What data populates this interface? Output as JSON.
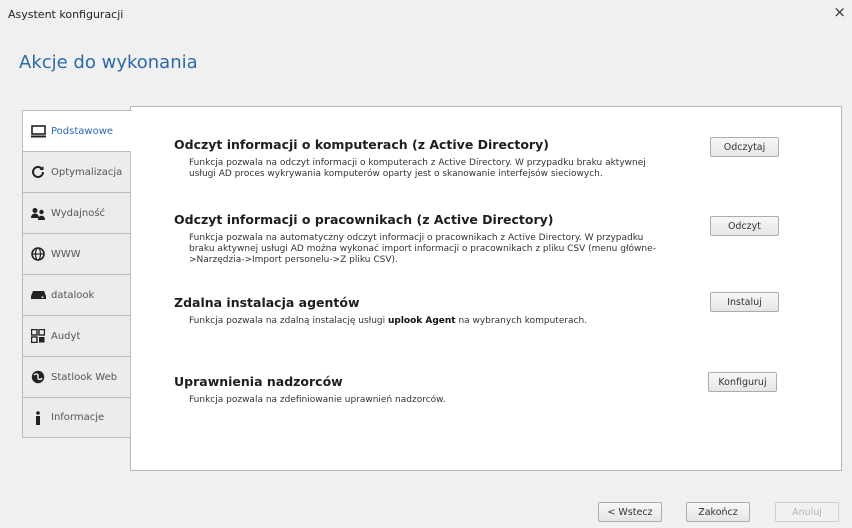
{
  "window": {
    "title": "Asystent konfiguracji",
    "close_label": "×"
  },
  "header": {
    "title": "Akcje do wykonania"
  },
  "tabs": [
    {
      "label": "Podstawowe",
      "icon": "monitor-icon"
    },
    {
      "label": "Optymalizacja",
      "icon": "refresh-icon"
    },
    {
      "label": "Wydajność",
      "icon": "people-icon"
    },
    {
      "label": "WWW",
      "icon": "globe-icon"
    },
    {
      "label": "datalook",
      "icon": "drive-icon"
    },
    {
      "label": "Audyt",
      "icon": "grid-icon"
    },
    {
      "label": "Statlook Web",
      "icon": "web-icon"
    },
    {
      "label": "Informacje",
      "icon": "info-icon"
    }
  ],
  "sections": [
    {
      "title": "Odczyt informacji o komputerach (z Active Directory)",
      "description": "Funkcja pozwala na odczyt informacji o komputerach z Active Directory. W przypadku braku aktywnej usługi AD proces wykrywania komputerów oparty jest o skanowanie interfejsów sieciowych.",
      "button": "Odczytaj"
    },
    {
      "title": "Odczyt informacji o pracownikach (z Active Directory)",
      "description": "Funkcja pozwala na automatyczny odczyt informacji o pracownikach z Active Directory. W przypadku braku aktywnej usługi AD można wykonać import informacji o pracownikach z pliku CSV (menu główne->Narzędzia->Import personelu->Z pliku CSV).",
      "button": "Odczyt"
    },
    {
      "title": "Zdalna instalacja agentów",
      "description_pre": "Funkcja pozwala na zdalną instalację usługi ",
      "description_bold": "uplook Agent",
      "description_post": " na wybranych komputerach.",
      "button": "Instaluj"
    },
    {
      "title": "Uprawnienia nadzorców",
      "description": "Funkcja pozwala na zdefiniowanie uprawnień nadzorców.",
      "button": "Konfiguruj"
    }
  ],
  "footer": {
    "back": "< Wstecz",
    "finish": "Zakończ",
    "cancel": "Anuluj"
  }
}
